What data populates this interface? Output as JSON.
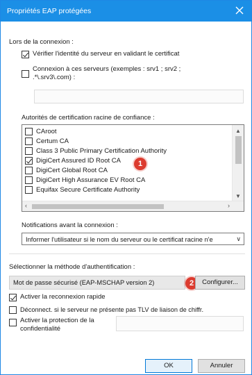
{
  "window": {
    "title": "Propriétés EAP protégées"
  },
  "connection": {
    "section_label": "Lors de la connexion :",
    "verify_cert_label": "Vérifier l'identité du serveur en validant le certificat",
    "verify_cert_checked": true,
    "connect_servers_label_line1": "Connexion à ces serveurs (exemples : srv1 ; srv2 ;",
    "connect_servers_label_line2": ".*\\.srv3\\.com) :",
    "connect_servers_checked": false,
    "servers_value": ""
  },
  "ca": {
    "section_label": "Autorités de certification racine de confiance :",
    "items": [
      {
        "label": "CAroot",
        "checked": false
      },
      {
        "label": "Certum CA",
        "checked": false
      },
      {
        "label": "Class 3 Public Primary Certification Authority",
        "checked": false
      },
      {
        "label": "DigiCert Assured ID Root CA",
        "checked": true
      },
      {
        "label": "DigiCert Global Root CA",
        "checked": false
      },
      {
        "label": "DigiCert High Assurance EV Root CA",
        "checked": false
      },
      {
        "label": "Equifax Secure Certificate Authority",
        "checked": false
      }
    ]
  },
  "notifications": {
    "label": "Notifications avant la connexion :",
    "selected": "Informer l'utilisateur si le nom du serveur ou le certificat racine n'e"
  },
  "auth": {
    "label": "Sélectionner la méthode d'authentification :",
    "selected": "Mot de passe sécurisé (EAP-MSCHAP version 2)",
    "configure_label": "Configurer..."
  },
  "options": {
    "fast_reconnect_label": "Activer la reconnexion rapide",
    "fast_reconnect_checked": true,
    "disconnect_label": "Déconnect. si le serveur ne présente pas TLV de liaison de chiffr.",
    "disconnect_checked": false,
    "privacy_label_line1": "Activer la protection de la",
    "privacy_label_line2": "confidentialité",
    "privacy_checked": false,
    "privacy_value": ""
  },
  "buttons": {
    "ok": "OK",
    "cancel": "Annuler"
  },
  "markers": {
    "one": "1",
    "two": "2"
  },
  "colors": {
    "titlebar": "#1b8fe6",
    "marker": "#dc3b2f"
  }
}
